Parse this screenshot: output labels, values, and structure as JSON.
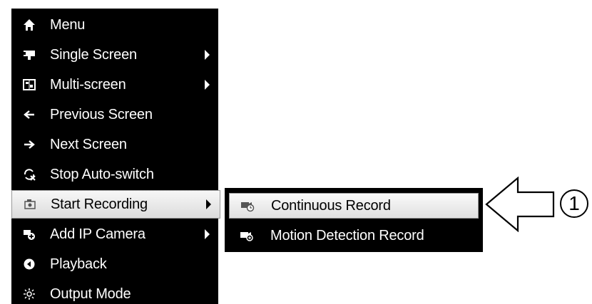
{
  "main_menu": {
    "items": [
      {
        "label": "Menu",
        "icon": "home-icon",
        "submenu": false
      },
      {
        "label": "Single Screen",
        "icon": "single-screen-icon",
        "submenu": true
      },
      {
        "label": "Multi-screen",
        "icon": "multi-screen-icon",
        "submenu": true
      },
      {
        "label": "Previous Screen",
        "icon": "arrow-left-icon",
        "submenu": false
      },
      {
        "label": "Next Screen",
        "icon": "arrow-right-icon",
        "submenu": false
      },
      {
        "label": "Stop Auto-switch",
        "icon": "auto-switch-icon",
        "submenu": false
      },
      {
        "label": "Start Recording",
        "icon": "recording-icon",
        "submenu": true,
        "highlighted": true
      },
      {
        "label": "Add IP Camera",
        "icon": "add-camera-icon",
        "submenu": true
      },
      {
        "label": "Playback",
        "icon": "playback-icon",
        "submenu": false
      },
      {
        "label": "Output Mode",
        "icon": "output-mode-icon",
        "submenu": false
      }
    ]
  },
  "sub_menu": {
    "items": [
      {
        "label": "Continuous Record",
        "icon": "continuous-record-icon",
        "highlighted": true
      },
      {
        "label": "Motion Detection Record",
        "icon": "motion-record-icon",
        "highlighted": false
      }
    ]
  },
  "callout": {
    "number": "1"
  }
}
